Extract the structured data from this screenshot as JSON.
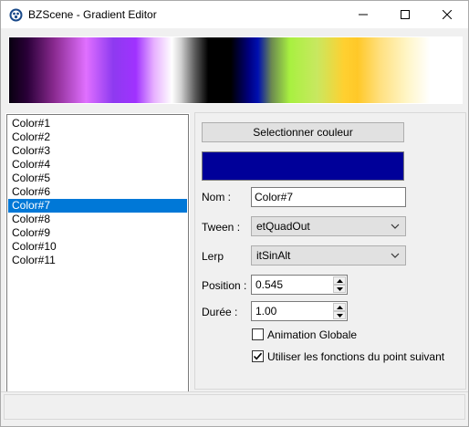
{
  "window": {
    "title": "BZScene - Gradient Editor"
  },
  "colors": {
    "selected_swatch": "#000099",
    "selection_bg": "#0078d7"
  },
  "color_list": {
    "items": [
      "Color#1",
      "Color#2",
      "Color#3",
      "Color#4",
      "Color#5",
      "Color#6",
      "Color#7",
      "Color#8",
      "Color#9",
      "Color#10",
      "Color#11"
    ],
    "selected": "Color#7"
  },
  "properties": {
    "select_color_label": "Selectionner couleur",
    "nom_label": "Nom :",
    "nom_value": "Color#7",
    "tween_label": "Tween :",
    "tween_value": "etQuadOut",
    "lerp_label": "Lerp",
    "lerp_value": "itSinAlt",
    "position_label": "Position :",
    "position_value": "0.545",
    "duree_label": "Durée :",
    "duree_value": "1.00",
    "animation_globale_label": "Animation Globale",
    "animation_globale_checked": false,
    "utiliser_label": "Utiliser les fonctions du point suivant",
    "utiliser_checked": true
  }
}
